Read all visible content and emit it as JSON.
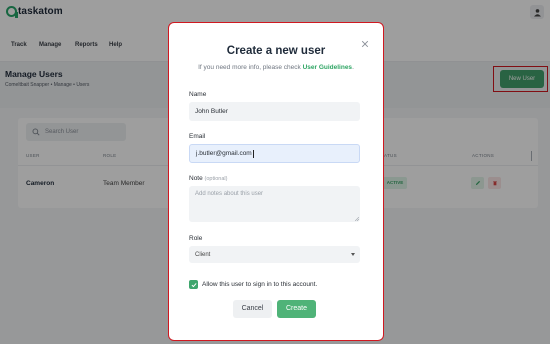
{
  "app": {
    "logo_text": "taskatom"
  },
  "nav": {
    "items": [
      "Track",
      "Manage",
      "Reports",
      "Help"
    ]
  },
  "page": {
    "title": "Manage Users",
    "breadcrumb": "Comeltbait Snapper  •  Manage  •  Users",
    "new_user_label": "New User"
  },
  "table": {
    "search_placeholder": "Search User",
    "headers": {
      "user": "USER",
      "role": "ROLE",
      "status": "STATUS",
      "actions": "ACTIONS"
    },
    "rows": [
      {
        "name": "Cameron",
        "role": "Team Member",
        "status": "ACTIVE"
      }
    ]
  },
  "modal": {
    "title": "Create a new user",
    "subtitle_prefix": "If you need more info, please check ",
    "subtitle_link": "User Guidelines",
    "subtitle_suffix": ".",
    "name_label": "Name",
    "name_value": "John Butler",
    "email_label": "Email",
    "email_value": "j.butler@gmail.com",
    "note_label": "Note",
    "note_optional": "(optional)",
    "note_placeholder": "Add notes about this user",
    "role_label": "Role",
    "role_value": "Client",
    "checkbox_label": "Allow this user to sign in to this account.",
    "checkbox_checked": true,
    "cancel_label": "Cancel",
    "create_label": "Create"
  },
  "colors": {
    "accent": "#43a06c",
    "highlight_border": "#d01820"
  }
}
